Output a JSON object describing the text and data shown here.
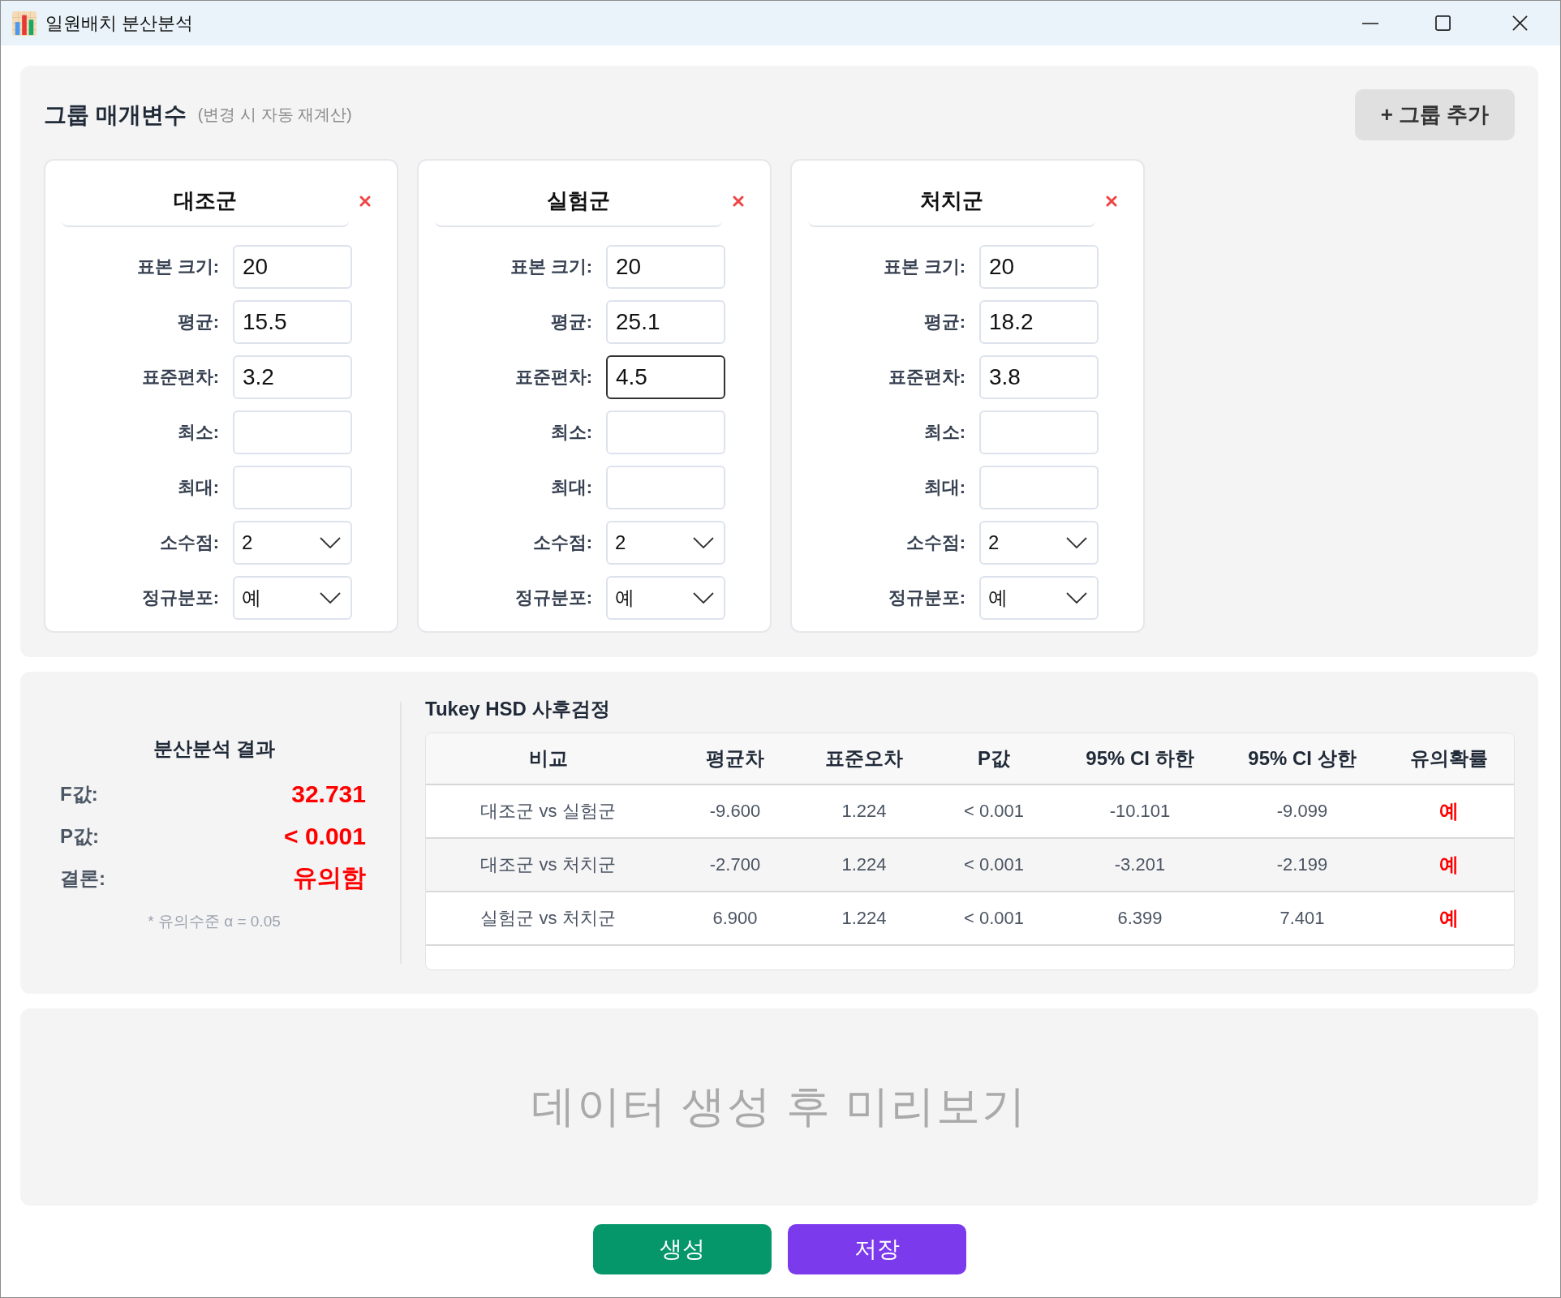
{
  "window": {
    "title": "일원배치 분산분석"
  },
  "parameters": {
    "title": "그룹 매개변수",
    "subtitle": "(변경 시 자동 재계산)",
    "add_button": "+ 그룹 추가",
    "groups": [
      {
        "name": "대조군",
        "fields": [
          {
            "label": "표본 크기:",
            "kind": "input",
            "value": "20",
            "focused": false
          },
          {
            "label": "평균:",
            "kind": "input",
            "value": "15.5",
            "focused": false
          },
          {
            "label": "표준편차:",
            "kind": "input",
            "value": "3.2",
            "focused": false
          },
          {
            "label": "최소:",
            "kind": "input",
            "focused": false
          },
          {
            "label": "최대:",
            "kind": "input",
            "focused": false
          },
          {
            "label": "소수점:",
            "kind": "select",
            "value": "2",
            "focused": false
          },
          {
            "label": "정규분포:",
            "kind": "select",
            "value": "예",
            "focused": false
          }
        ]
      },
      {
        "name": "실험군",
        "fields": [
          {
            "label": "표본 크기:",
            "kind": "input",
            "value": "20",
            "focused": false
          },
          {
            "label": "평균:",
            "kind": "input",
            "value": "25.1",
            "focused": false
          },
          {
            "label": "표준편차:",
            "kind": "input",
            "value": "4.5",
            "focused": true
          },
          {
            "label": "최소:",
            "kind": "input",
            "focused": false
          },
          {
            "label": "최대:",
            "kind": "input",
            "focused": false
          },
          {
            "label": "소수점:",
            "kind": "select",
            "value": "2",
            "focused": false
          },
          {
            "label": "정규분포:",
            "kind": "select",
            "value": "예",
            "focused": false
          }
        ]
      },
      {
        "name": "처치군",
        "fields": [
          {
            "label": "표본 크기:",
            "kind": "input",
            "value": "20",
            "focused": false
          },
          {
            "label": "평균:",
            "kind": "input",
            "value": "18.2",
            "focused": false
          },
          {
            "label": "표준편차:",
            "kind": "input",
            "value": "3.8",
            "focused": false
          },
          {
            "label": "최소:",
            "kind": "input",
            "focused": false
          },
          {
            "label": "최대:",
            "kind": "input",
            "focused": false
          },
          {
            "label": "소수점:",
            "kind": "select",
            "value": "2",
            "focused": false
          },
          {
            "label": "정규분포:",
            "kind": "select",
            "value": "예",
            "focused": false
          }
        ]
      }
    ]
  },
  "anova": {
    "title": "분산분석 결과",
    "rows": [
      {
        "label": "F값:",
        "value": "32.731"
      },
      {
        "label": "P값:",
        "value": "< 0.001"
      },
      {
        "label": "결론:",
        "value": "유의함"
      }
    ],
    "note": "* 유의수준 α = 0.05"
  },
  "tukey": {
    "title": "Tukey HSD 사후검정",
    "columns": [
      "비교",
      "평균차",
      "표준오차",
      "P값",
      "95% CI 하한",
      "95% CI 상한",
      "유의확률"
    ],
    "rows": [
      {
        "cells": [
          "대조군 vs 실험군",
          "-9.600",
          "1.224",
          "< 0.001",
          "-10.101",
          "-9.099",
          "예"
        ],
        "significant": true
      },
      {
        "cells": [
          "대조군 vs 처치군",
          "-2.700",
          "1.224",
          "< 0.001",
          "-3.201",
          "-2.199",
          "예"
        ],
        "significant": true
      },
      {
        "cells": [
          "실험군 vs 처치군",
          "6.900",
          "1.224",
          "< 0.001",
          "6.399",
          "7.401",
          "예"
        ],
        "significant": true
      }
    ]
  },
  "preview": {
    "message": "데이터 생성 후 미리보기"
  },
  "buttons": [
    {
      "label": "생성",
      "kind": "generate"
    },
    {
      "label": "저장",
      "kind": "save"
    }
  ]
}
